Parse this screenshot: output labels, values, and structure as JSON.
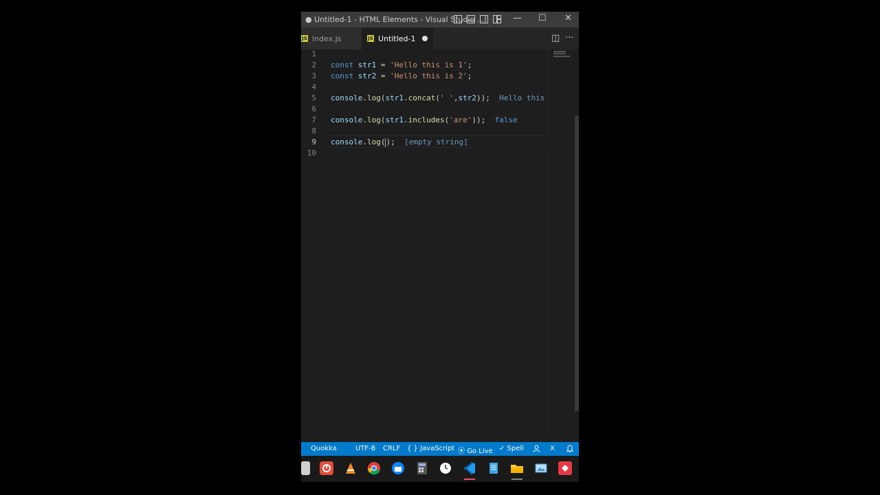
{
  "window": {
    "title": "● Untitled-1 - HTML Elements - Visual Studio ..."
  },
  "window_controls": {
    "minimize": "—",
    "maximize": "☐",
    "close": "✕"
  },
  "tabs": [
    {
      "label": "index.js",
      "badge": "JS"
    },
    {
      "label": "Untitled-1",
      "badge": "JS"
    }
  ],
  "tab_actions": {
    "split": "◫",
    "more": "···"
  },
  "editor": {
    "line_numbers": [
      "1",
      "2",
      "3",
      "4",
      "5",
      "6",
      "7",
      "8",
      "9",
      "10"
    ],
    "line2": {
      "kw": "const",
      "var": "str1",
      "op": " = ",
      "str": "'Hello this is 1'",
      "end": ";"
    },
    "line3": {
      "kw": "const",
      "var": "str2",
      "op": " = ",
      "str": "'Hello this is 2'",
      "end": ";"
    },
    "line5": {
      "obj": "console",
      "dot": ".",
      "fn": "log",
      "open": "(",
      "arg": "str1",
      "dot2": ".",
      "fn2": "concat",
      "open2": "(",
      "str": "' '",
      "comma": ",",
      "arg2": "str2",
      "close": "));",
      "result": "Hello this i"
    },
    "line7": {
      "obj": "console",
      "dot": ".",
      "fn": "log",
      "open": "(",
      "arg": "str1",
      "dot2": ".",
      "fn2": "includes",
      "open2": "(",
      "str": "'are'",
      "close": "));",
      "result": "false"
    },
    "line9": {
      "obj": "console",
      "dot": ".",
      "fn": "log",
      "open": "(",
      "close": ");",
      "result": "[empty string]"
    }
  },
  "statusbar": {
    "quokka": "Quokka",
    "encoding": "UTF-8",
    "eol": "CRLF",
    "language": "{ } JavaScript",
    "golive": "Go Live",
    "spell": "✓ Spell",
    "x": "X",
    "bell": "🔔"
  },
  "taskbar": {
    "icons": [
      "explorer-icon",
      "power-icon",
      "vlc-icon",
      "chrome-icon",
      "thunderbird-icon",
      "calculator-icon",
      "clock-icon",
      "vscode-icon",
      "notepad-icon",
      "folder-icon",
      "paint-icon",
      "anydesk-icon"
    ]
  },
  "colors": {
    "accent": "#007acc",
    "editor_bg": "#1e1e1e",
    "keyword": "#569cd6",
    "string": "#ce9178",
    "function": "#dcdcaa",
    "variable": "#9cdcfe"
  }
}
